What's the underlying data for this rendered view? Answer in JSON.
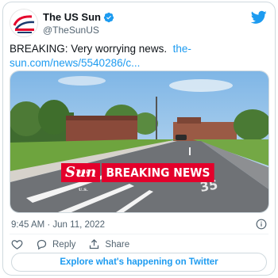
{
  "account": {
    "display_name": "The US Sun",
    "handle": "@TheSunUS",
    "verified": true
  },
  "tweet": {
    "text": "BREAKING: Very worrying news.",
    "link_line1": "the-",
    "link_line2": "sun.com/news/5540286/c..."
  },
  "media": {
    "banner_logo": "Sun",
    "banner_logo_small": "THE U.S.",
    "banner_text": "BREAKING NEWS",
    "road_marking": "35"
  },
  "meta": {
    "timestamp": "9:45 AM · Jun 11, 2022"
  },
  "actions": {
    "reply_label": "Reply",
    "share_label": "Share"
  },
  "explore_label": "Explore what's happening on Twitter",
  "colors": {
    "accent": "#1d9bf0",
    "sun_red": "#e4002b",
    "text": "#0f1419",
    "secondary": "#536471"
  }
}
